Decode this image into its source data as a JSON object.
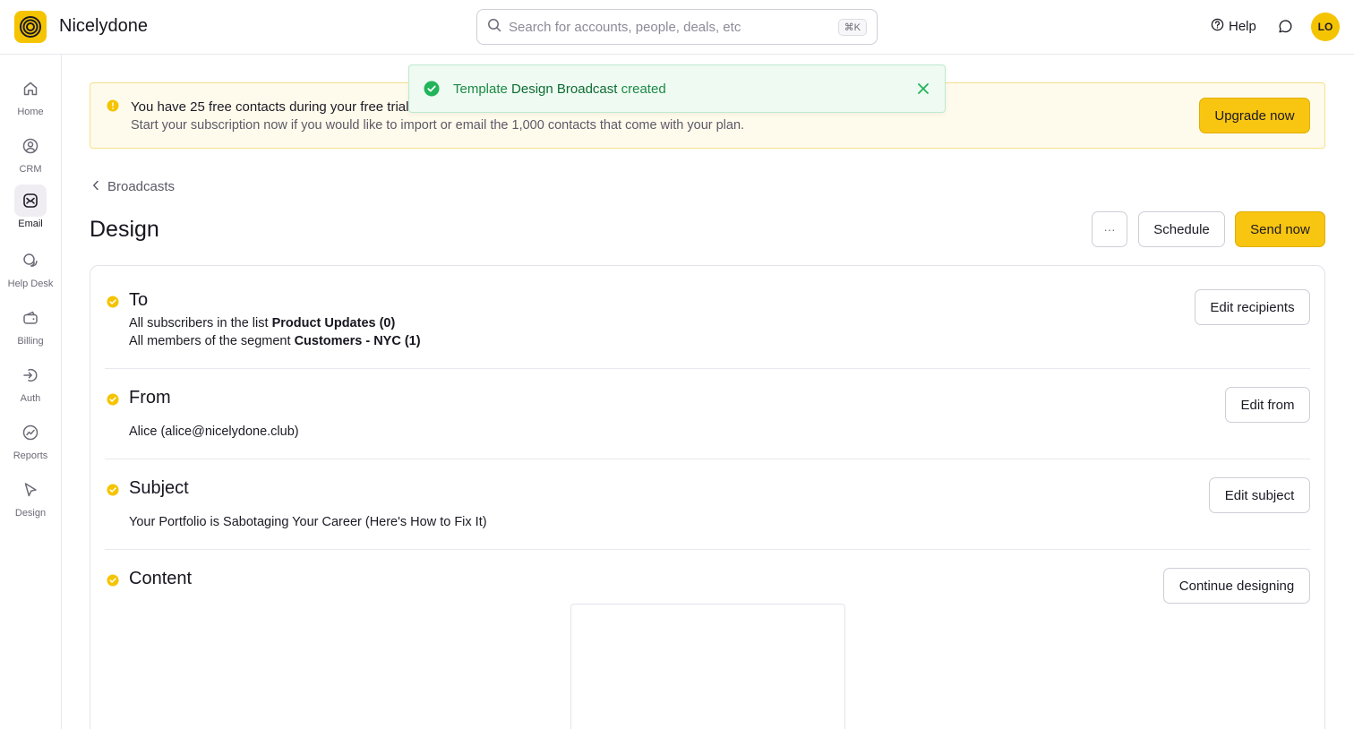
{
  "app": {
    "name": "Nicelydone",
    "avatar_initials": "LO",
    "help_label": "Help"
  },
  "search": {
    "placeholder": "Search for accounts, people, deals, etc",
    "shortcut": "⌘K"
  },
  "sidebar": {
    "items": [
      {
        "label": "Home",
        "icon": "home-icon",
        "active": false
      },
      {
        "label": "CRM",
        "icon": "user-circle-icon",
        "active": false
      },
      {
        "label": "Email",
        "icon": "mail-icon",
        "active": true
      },
      {
        "label": "Help Desk",
        "icon": "chat-bubbles-icon",
        "active": false
      },
      {
        "label": "Billing",
        "icon": "wallet-icon",
        "active": false
      },
      {
        "label": "Auth",
        "icon": "login-arrow-icon",
        "active": false
      },
      {
        "label": "Reports",
        "icon": "chart-circle-icon",
        "active": false
      },
      {
        "label": "Design",
        "icon": "cursor-icon",
        "active": false
      }
    ]
  },
  "banner": {
    "title": "You have 25 free contacts during your free trial",
    "subtitle": "Start your subscription now if you would like to import or email the 1,000 contacts that come with your plan.",
    "button": "Upgrade now"
  },
  "toast": {
    "prefix": "Template",
    "name": "Design Broadcast",
    "suffix": "created"
  },
  "breadcrumb": {
    "label": "Broadcasts"
  },
  "page": {
    "title": "Design"
  },
  "actions": {
    "more": "···",
    "schedule": "Schedule",
    "send": "Send now"
  },
  "sections": {
    "to": {
      "title": "To",
      "line1_prefix": "All subscribers in the list",
      "line1_value": "Product Updates (0)",
      "line2_prefix": "All members of the segment",
      "line2_value": "Customers - NYC (1)",
      "button": "Edit recipients"
    },
    "from": {
      "title": "From",
      "value": "Alice (alice@nicelydone.club)",
      "button": "Edit from"
    },
    "subject": {
      "title": "Subject",
      "value": "Your Portfolio is Sabotaging Your Career (Here's How to Fix It)",
      "button": "Edit subject"
    },
    "content": {
      "title": "Content",
      "button": "Continue designing"
    }
  },
  "colors": {
    "accent": "#f8c510",
    "success": "#1c8a45",
    "banner_bg": "#fffbec",
    "toast_bg": "#eefaf2"
  }
}
